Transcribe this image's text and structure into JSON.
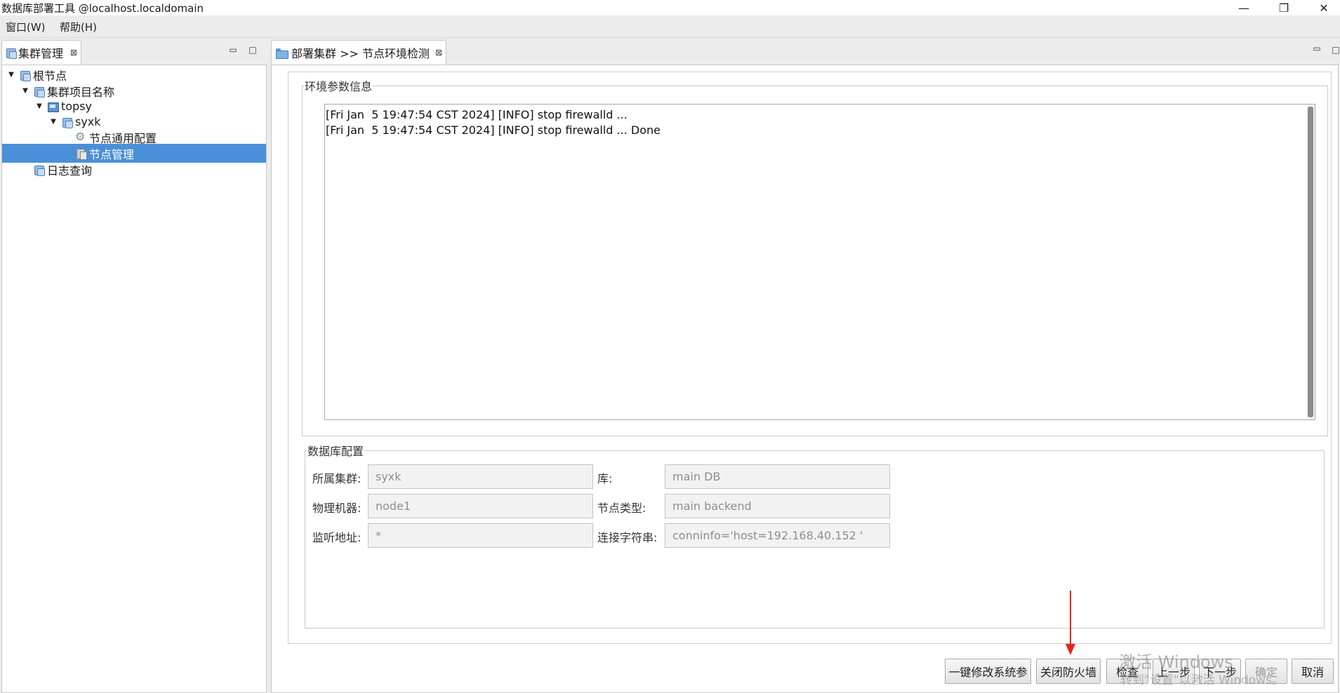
{
  "window": {
    "title": "数据库部署工具 @localhost.localdomain",
    "controls": {
      "minimize": "—",
      "restore": "❐",
      "close": "✕"
    }
  },
  "menubar": {
    "items": [
      "窗口(W)",
      "帮助(H)"
    ]
  },
  "left_view": {
    "tab_label": "集群管理",
    "tab_close": "⊠",
    "tree": [
      {
        "label": "根节点",
        "level": 0,
        "expanded": true,
        "icon": "cluster-icon"
      },
      {
        "label": "集群项目名称",
        "level": 1,
        "expanded": true,
        "icon": "cluster-icon"
      },
      {
        "label": "topsy",
        "level": 2,
        "expanded": true,
        "icon": "host-icon"
      },
      {
        "label": "syxk",
        "level": 3,
        "expanded": true,
        "icon": "cluster-icon"
      },
      {
        "label": "节点通用配置",
        "level": 4,
        "icon": "gear-icon"
      },
      {
        "label": "节点管理",
        "level": 4,
        "icon": "node-icon",
        "selected": true
      },
      {
        "label": "日志查询",
        "level": 1,
        "icon": "cluster-icon"
      }
    ]
  },
  "editor": {
    "tab_label": "部署集群 >> 节点环境检测",
    "tab_close": "⊠",
    "env_group": {
      "legend": "环境参数信息",
      "log_lines": [
        "[Fri Jan  5 19:47:54 CST 2024] [INFO] stop firewalld ...",
        "[Fri Jan  5 19:47:54 CST 2024] [INFO] stop firewalld ... Done"
      ]
    },
    "db_group": {
      "legend": "数据库配置",
      "fields": {
        "cluster_label": "所属集群:",
        "cluster_value": "syxk",
        "db_label": "库:",
        "db_value": "main DB",
        "machine_label": "物理机器:",
        "machine_value": "node1",
        "node_type_label": "节点类型:",
        "node_type_value": "main backend",
        "listen_label": "监听地址:",
        "listen_value": "*",
        "conn_label": "连接字符串:",
        "conn_value": "conninfo='host=192.168.40.152 '"
      }
    },
    "buttons": {
      "modify_system": "一键修改系统参",
      "close_firewall": "关闭防火墙",
      "check": "检查",
      "prev": "上一步",
      "next": "下一步",
      "confirm": "确定",
      "cancel": "取消"
    }
  },
  "watermark": {
    "line1": "激活 Windows",
    "line2": "转到\"设置\"以激活 Windows。"
  },
  "colors": {
    "selection": "#4a90d9",
    "annotation_arrow": "#e8231f"
  }
}
